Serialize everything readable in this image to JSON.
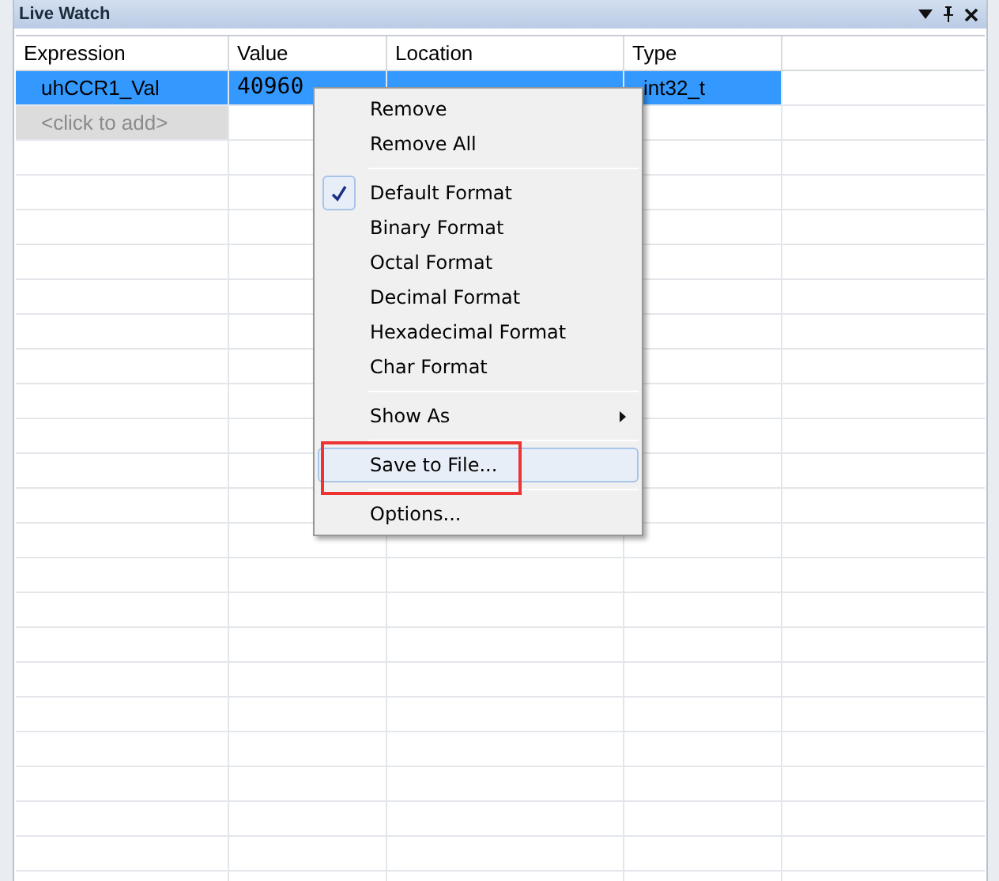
{
  "window": {
    "title": "Live Watch"
  },
  "table": {
    "columns": [
      "Expression",
      "Value",
      "Location",
      "Type"
    ],
    "rows": [
      {
        "expression": "uhCCR1_Val",
        "value": "40960",
        "type": "int32_t",
        "selected": true
      }
    ],
    "add_row": {
      "placeholder": "<click to add>"
    }
  },
  "context_menu": {
    "items": [
      {
        "kind": "item",
        "label": "Remove",
        "checked": false,
        "selected": false
      },
      {
        "kind": "item",
        "label": "Remove All",
        "checked": false,
        "selected": false
      },
      {
        "kind": "separator"
      },
      {
        "kind": "item",
        "label": "Default Format",
        "checked": true,
        "selected": false
      },
      {
        "kind": "item",
        "label": "Binary Format",
        "checked": false,
        "selected": false
      },
      {
        "kind": "item",
        "label": "Octal Format",
        "checked": false,
        "selected": false
      },
      {
        "kind": "item",
        "label": "Decimal Format",
        "checked": false,
        "selected": false
      },
      {
        "kind": "item",
        "label": "Hexadecimal Format",
        "checked": false,
        "selected": false
      },
      {
        "kind": "item",
        "label": "Char Format",
        "checked": false,
        "selected": false
      },
      {
        "kind": "separator"
      },
      {
        "kind": "submenu",
        "label": "Show As",
        "checked": false,
        "selected": false
      },
      {
        "kind": "separator"
      },
      {
        "kind": "item",
        "label": "Save to File...",
        "checked": false,
        "selected": true,
        "annotated": true
      },
      {
        "kind": "separator"
      },
      {
        "kind": "item",
        "label": "Options...",
        "checked": false,
        "selected": false
      }
    ]
  }
}
